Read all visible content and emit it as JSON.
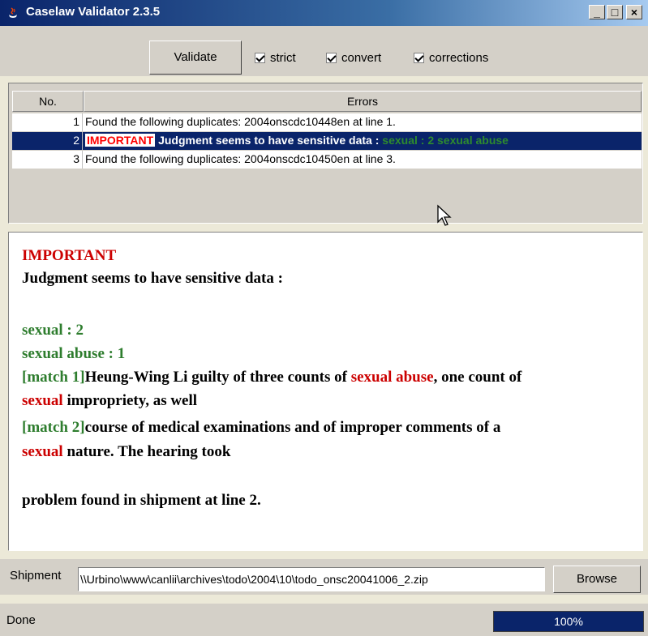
{
  "window": {
    "title": "Caselaw Validator 2.3.5",
    "controls": [
      "_",
      "□",
      "×"
    ]
  },
  "toolbar": {
    "validate_label": "Validate",
    "checkboxes": [
      {
        "label": "strict",
        "checked": true
      },
      {
        "label": "convert",
        "checked": true
      },
      {
        "label": "corrections",
        "checked": true
      }
    ]
  },
  "table": {
    "headers": [
      "No.",
      "Errors"
    ],
    "rows": [
      {
        "no": "1",
        "error": "Found the following duplicates: 2004onscdc10448en at line 1.",
        "selected": false
      },
      {
        "no": "2",
        "important": "IMPORTANT",
        "error": "Judgment seems to have sensitive data :",
        "sensitive": "sexual : 2 sexual abuse",
        "selected": true
      },
      {
        "no": "3",
        "error": "Found the following duplicates: 2004onscdc10450en at line 3.",
        "selected": false
      }
    ]
  },
  "detail": {
    "important": "IMPORTANT",
    "heading": "Judgment seems to have sensitive data :",
    "terms": [
      "sexual : 2",
      "sexual abuse : 1"
    ],
    "match1_tag": "[match 1]",
    "match1_pre": "Heung-Wing Li guilty of three counts of ",
    "match1_hl1": "sexual abuse",
    "match1_mid": ", one count of",
    "match1_hl2": "sexual",
    "match1_post": " impropriety, as well",
    "match2_tag": "[match 2]",
    "match2_pre": "course of medical examinations and of improper comments of a",
    "match2_hl": "sexual",
    "match2_post": " nature. The hearing took",
    "footer": "problem found in shipment at line 2."
  },
  "shipment": {
    "label": "Shipment",
    "value": "\\\\Urbino\\www\\canlii\\archives\\todo\\2004\\10\\todo_onsc20041006_2.zip",
    "browse_label": "Browse"
  },
  "status": {
    "text": "Done",
    "progress_label": "100%",
    "progress_value": 1.0
  },
  "colors": {
    "selection": "#0a246a",
    "important": "#cc0000",
    "sensitive": "#2e7d2e"
  }
}
